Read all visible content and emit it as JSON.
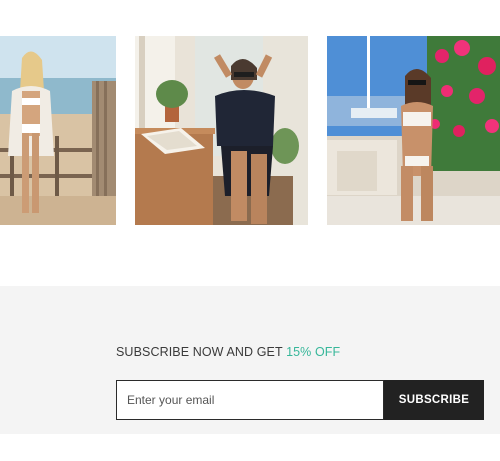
{
  "gallery": {
    "images": [
      {
        "name": "beach-deck-photo"
      },
      {
        "name": "balcony-chair-photo"
      },
      {
        "name": "poolside-flowers-photo"
      }
    ]
  },
  "newsletter": {
    "heading_prefix": "SUBSCRIBE NOW AND GET ",
    "heading_offer": "15% OFF",
    "email_placeholder": "Enter your email",
    "button_label": "SUBSCRIBE"
  },
  "colors": {
    "accent": "#37b79a",
    "button_bg": "#222222",
    "section_bg": "#f4f4f4"
  }
}
